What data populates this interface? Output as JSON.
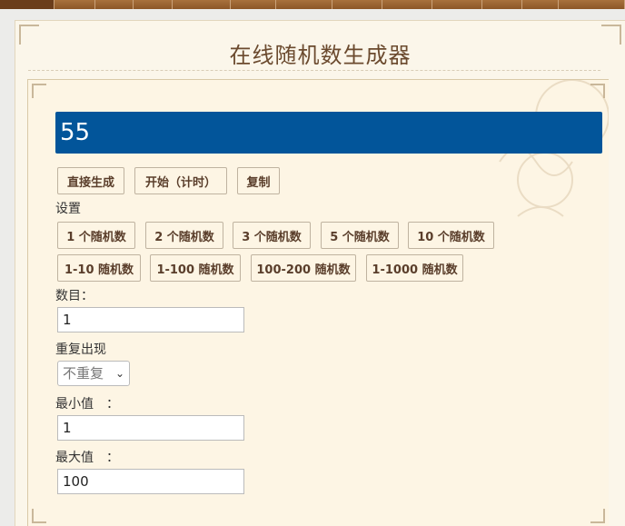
{
  "page": {
    "title": "在线随机数生成器"
  },
  "display": {
    "value": "55"
  },
  "actions": {
    "generate": "直接生成",
    "start_timed": "开始（计时）",
    "copy": "复制"
  },
  "settings": {
    "label": "设置",
    "count_presets": [
      "1 个随机数",
      "2 个随机数",
      "3 个随机数",
      "5 个随机数",
      "10 个随机数"
    ],
    "range_presets": [
      "1-10 随机数",
      "1-100 随机数",
      "100-200 随机数",
      "1-1000 随机数"
    ]
  },
  "form": {
    "count_label": "数目：",
    "count_value": "1",
    "repeat_label": "重复出现",
    "repeat_selected": "不重复",
    "min_label": "最小值　：",
    "min_value": "1",
    "max_label": "最大值　：",
    "max_value": "100"
  },
  "colors": {
    "display_bg": "#02559a",
    "title": "#6b4a2e",
    "nav": "#8b5a2b",
    "panel_bg": "#fdf5e4"
  }
}
